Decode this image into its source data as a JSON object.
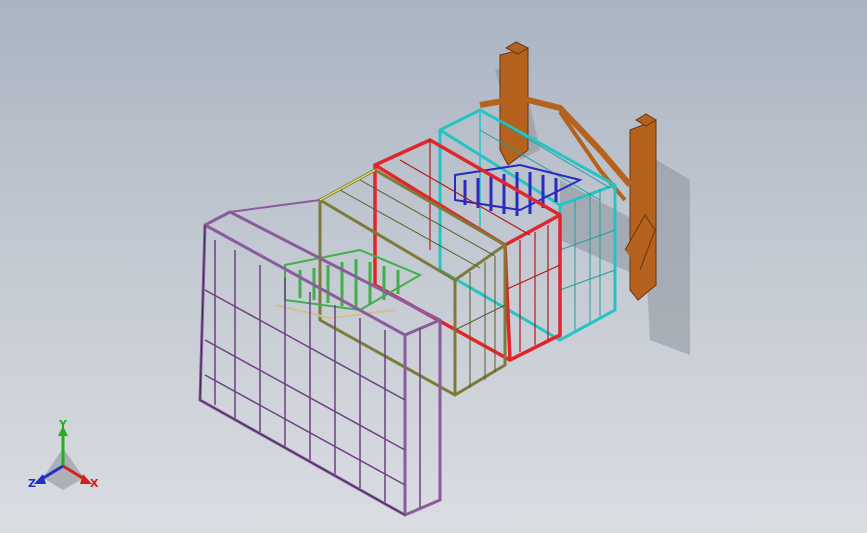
{
  "viewport": {
    "background_top": "#a9b3c1",
    "background_bottom": "#dadde2"
  },
  "model": {
    "frames": [
      {
        "name": "purple-front-frame",
        "color": "#8a5c9e"
      },
      {
        "name": "green-inner-module",
        "color": "#3fb04a"
      },
      {
        "name": "olive-frame",
        "color": "#7e7a3a"
      },
      {
        "name": "red-frame",
        "color": "#e0262a"
      },
      {
        "name": "blue-inner-module",
        "color": "#2a2ac0"
      },
      {
        "name": "cyan-frame",
        "color": "#25c4c4"
      },
      {
        "name": "orange-support",
        "color": "#b4621e"
      }
    ]
  },
  "triad": {
    "x_label": "X",
    "y_label": "Y",
    "z_label": "Z",
    "x_color": "#d42020",
    "y_color": "#20b020",
    "z_color": "#2030c8"
  }
}
